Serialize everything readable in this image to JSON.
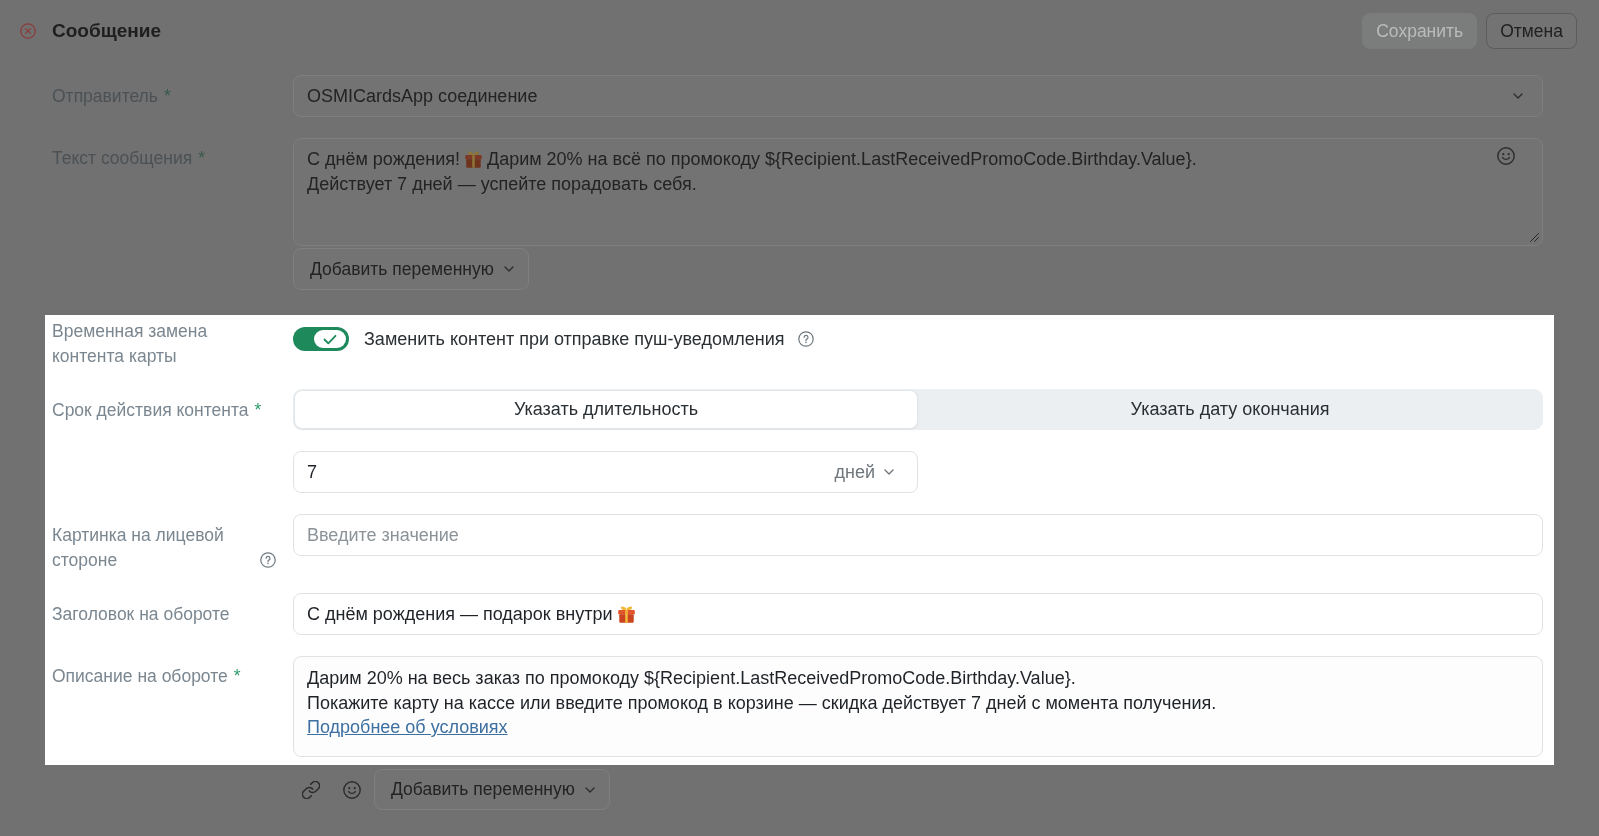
{
  "header": {
    "dimmed": true,
    "title": "Сообщение",
    "buttons": [
      {
        "label": "Сохранить",
        "disabled": true
      },
      {
        "label": "Отмена",
        "disabled": false
      }
    ]
  },
  "rows": [
    {
      "kind": "select",
      "dimmed": true,
      "label": "Отправитель",
      "required_mark": "*",
      "value": "OSMICardsApp соединение"
    },
    {
      "kind": "textarea",
      "dimmed": true,
      "label": "Текст сообщения",
      "required_mark": "*",
      "lines": [
        {
          "segments": [
            {
              "kind": "text",
              "text": "С днём рождения!"
            },
            {
              "kind": "emoji"
            },
            {
              "kind": "text",
              "text": "Дарим 20% на всё по промокоду ${Recipient.LastReceivedPromoCode.Birthday.Value}."
            }
          ]
        },
        {
          "segments": [
            {
              "kind": "text",
              "text": "Действует 7 дней — успейте порадовать себя."
            }
          ]
        }
      ],
      "add_variable": "Добавить переменную"
    },
    {
      "kind": "toggle",
      "dimmed": false,
      "label": "Временная замена контента карты",
      "on": true,
      "text": "Заменить контент при отправке пуш-уведомления",
      "help": true
    },
    {
      "kind": "segmented",
      "dimmed": false,
      "label": "Срок действия контента",
      "required_mark": "*",
      "options": [
        {
          "label": "Указать длительность",
          "selected": true
        },
        {
          "label": "Указать дату окончания",
          "selected": false
        }
      ]
    },
    {
      "kind": "number",
      "dimmed": false,
      "value": "7",
      "unit": "дней"
    },
    {
      "kind": "input",
      "dimmed": false,
      "label": "Картинка на лицевой стороне",
      "help": true,
      "placeholder": "Введите значение"
    },
    {
      "kind": "input",
      "dimmed": false,
      "label": "Заголовок на обороте",
      "segments": [
        {
          "kind": "text",
          "text": "С днём рождения — подарок внутри"
        },
        {
          "kind": "emoji"
        }
      ]
    },
    {
      "kind": "textarea",
      "dimmed": false,
      "label": "Описание на обороте",
      "required_mark": "*",
      "lines": [
        {
          "segments": [
            {
              "kind": "text",
              "text": "Дарим 20% на весь заказ по промокоду ${Recipient.LastReceivedPromoCode.Birthday.Value}."
            }
          ]
        },
        {
          "segments": [
            {
              "kind": "text",
              "text": "Покажите карту на кассе или введите промокод в корзине — скидка действует 7 дней с момента получения."
            }
          ]
        }
      ],
      "link": "Подробнее об условиях"
    },
    {
      "kind": "toolbar",
      "dimmed": true,
      "add_variable": "Добавить переменную"
    }
  ]
}
